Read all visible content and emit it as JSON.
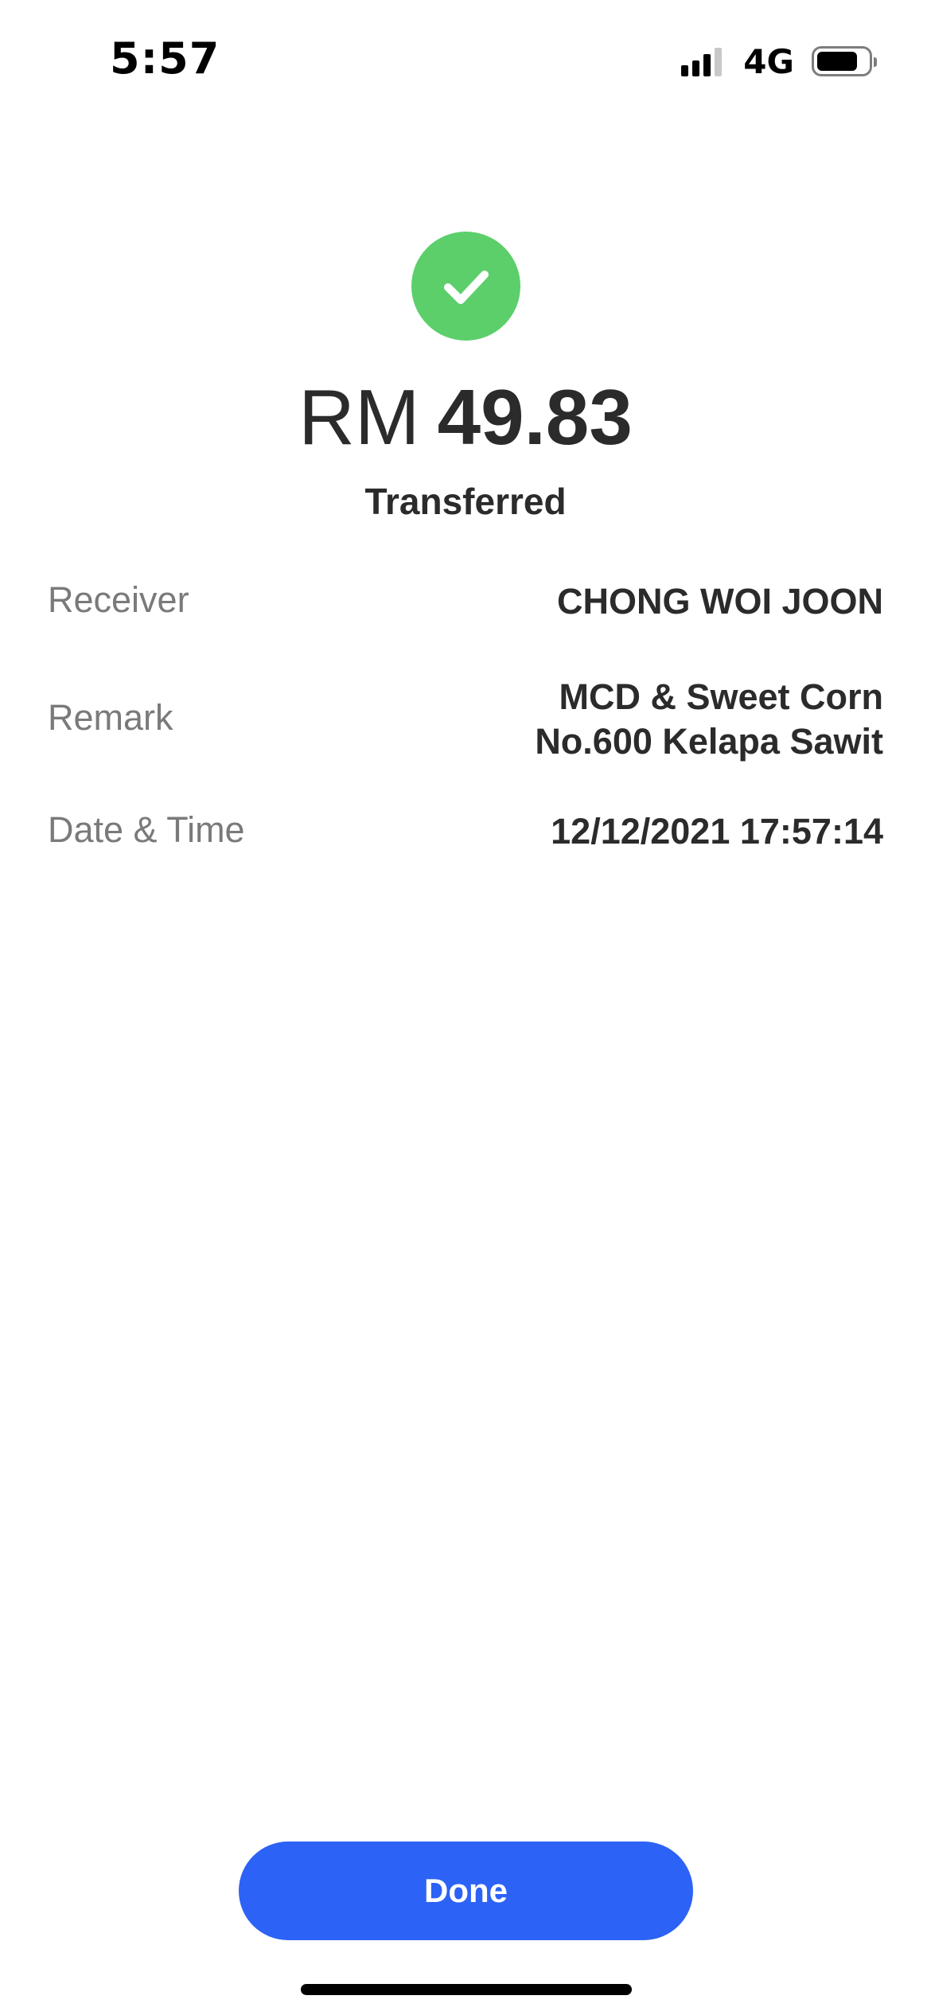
{
  "status_bar": {
    "time": "5:57",
    "network": "4G",
    "signal_bars": 3,
    "signal_bars_total": 4,
    "battery_level": 0.8
  },
  "transfer": {
    "currency": "RM",
    "amount": "49.83",
    "status": "Transferred",
    "success_color": "#5ccf6b"
  },
  "details": {
    "receiver_label": "Receiver",
    "receiver_value": "CHONG WOI JOON",
    "remark_label": "Remark",
    "remark_line1": "MCD & Sweet Corn",
    "remark_line2": "No.600 Kelapa Sawit",
    "datetime_label": "Date & Time",
    "datetime_value": "12/12/2021 17:57:14"
  },
  "actions": {
    "done_label": "Done",
    "accent_color": "#2c62f6"
  }
}
